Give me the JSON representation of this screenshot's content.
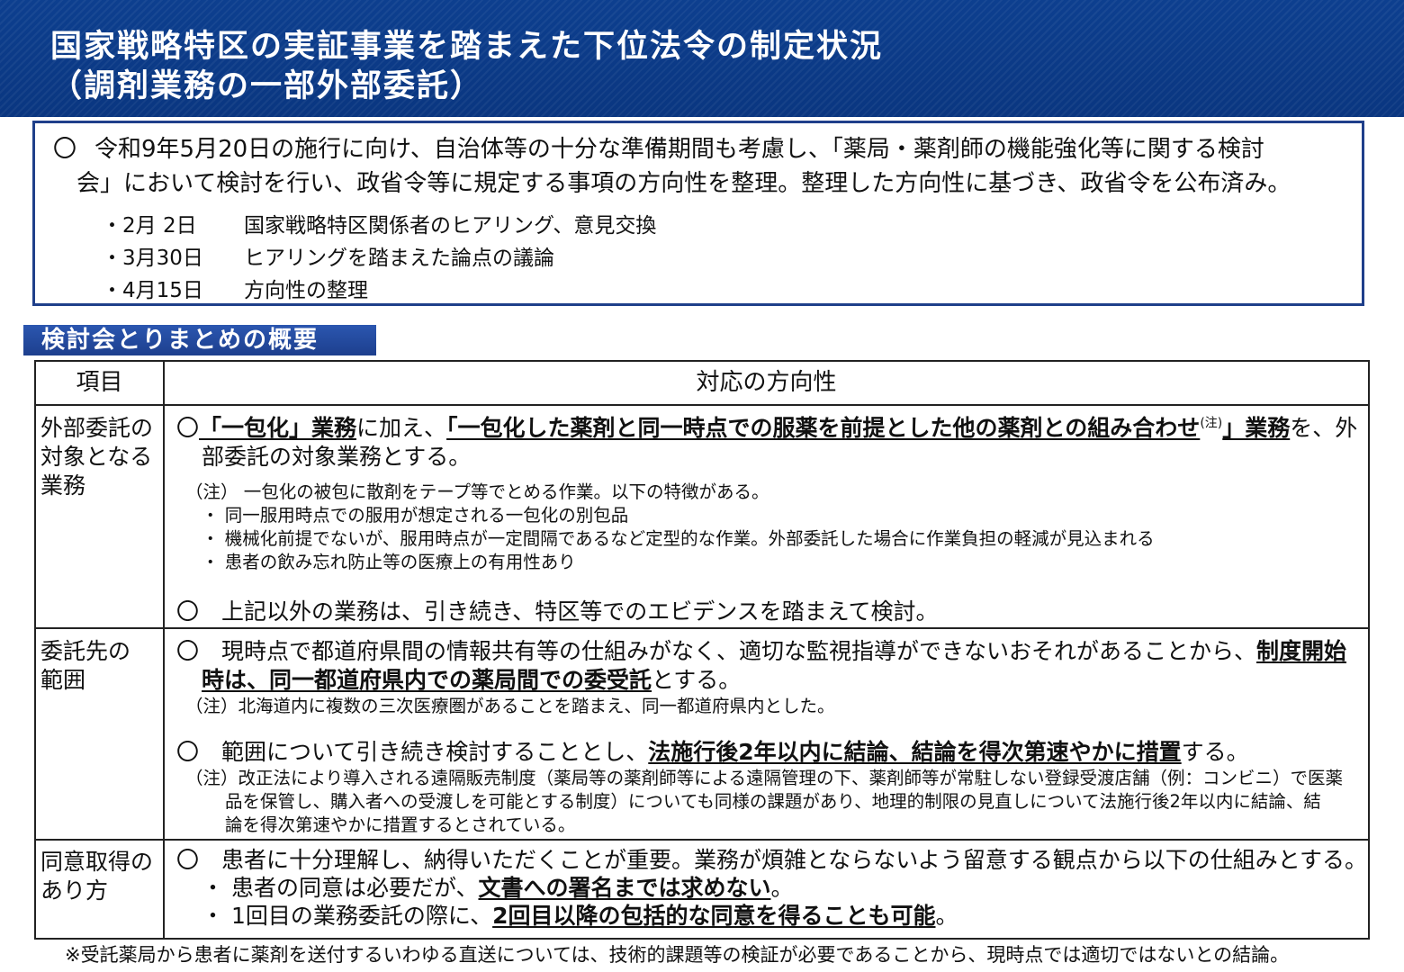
{
  "header": {
    "title_line1": "国家戦略特区の実証事業を踏まえた下位法令の制定状況",
    "title_line2": "（調剤業務の一部外部委託）"
  },
  "intro": {
    "bullet": "〇",
    "line1": "令和9年5月20日の施行に向け、自治体等の十分な準備期間も考慮し、「薬局・薬剤師の機能強化等に関する検討",
    "line2": "会」において検討を行い、政省令等に規定する事項の方向性を整理。整理した方向性に基づき、政省令を公布済み。",
    "schedule": [
      {
        "date": "・2月 2日",
        "text": "国家戦略特区関係者のヒアリング、意見交換"
      },
      {
        "date": "・3月30日",
        "text": "ヒアリングを踏まえた論点の議論"
      },
      {
        "date": "・4月15日",
        "text": "方向性の整理"
      }
    ]
  },
  "section": {
    "title": "検討会とりまとめの概要"
  },
  "table": {
    "header_item": "項目",
    "header_direction": "対応の方向性",
    "rows": [
      {
        "item": "外部委託の\n対象となる\n業務",
        "p1_a": "〇",
        "p1_b": "「一包化」業務",
        "p1_c": "に加え、",
        "p1_d": "「一包化した薬剤と同一時点での服薬を前提とした他の薬剤との組み合わせ",
        "p1_sup": "(注)",
        "p1_e": "」業務",
        "p1_f": "を、外",
        "p1_line2": "部委託の対象業務とする。",
        "note_head": "（注） 一包化の被包に散剤をテープ等でとめる作業。以下の特徴がある。",
        "note_items": [
          "・ 同一服用時点での服用が想定される一包化の別包品",
          "・ 機械化前提でないが、服用時点が一定間隔であるなど定型的な作業。外部委託した場合に作業負担の軽減が見込まれる",
          "・ 患者の飲み忘れ防止等の医療上の有用性あり"
        ],
        "p2": "〇　上記以外の業務は、引き続き、特区等でのエビデンスを踏まえて検討。"
      },
      {
        "item": "委託先の\n範囲",
        "p1_a": "〇　現時点で都道府県間の情報共有等の仕組みがなく、適切な監視指導ができないおそれがあることから、",
        "p1_em1": "制度開始",
        "p1_em2": "時は、同一都道府県内での薬局間での委受託",
        "p1_c": "とする。",
        "note1": "（注）北海道内に複数の三次医療圏があることを踏まえ、同一都道府県内とした。",
        "p2_a": "〇　範囲について引き続き検討することとし、",
        "p2_em": "法施行後2年以内に結論、結論を得次第速やかに措置",
        "p2_c": "する。",
        "note2_l1": "（注）改正法により導入される遠隔販売制度（薬局等の薬剤師等による遠隔管理の下、薬剤師等が常駐しない登録受渡店舗（例：コンビニ）で医薬",
        "note2_l2": "品を保管し、購入者への受渡しを可能とする制度）についても同様の課題があり、地理的制限の見直しについて法施行後2年以内に結論、結",
        "note2_l3": "論を得次第速やかに措置するとされている。"
      },
      {
        "item": "同意取得の\nあり方",
        "p1": "〇　患者に十分理解し、納得いただくことが重要。業務が煩雑とならないよう留意する観点から以下の仕組みとする。",
        "b1_a": "・ 患者の同意は必要だが、",
        "b1_em": "文書への署名までは求めない",
        "b1_c": "。",
        "b2_a": "・ 1回目の業務委託の際に、",
        "b2_em": "2回目以降の包括的な同意を得ることも可能",
        "b2_c": "。"
      }
    ]
  },
  "footer": "※受託薬局から患者に薬剤を送付するいわゆる直送については、技術的課題等の検証が必要であることから、現時点では適切ではないとの結論。"
}
